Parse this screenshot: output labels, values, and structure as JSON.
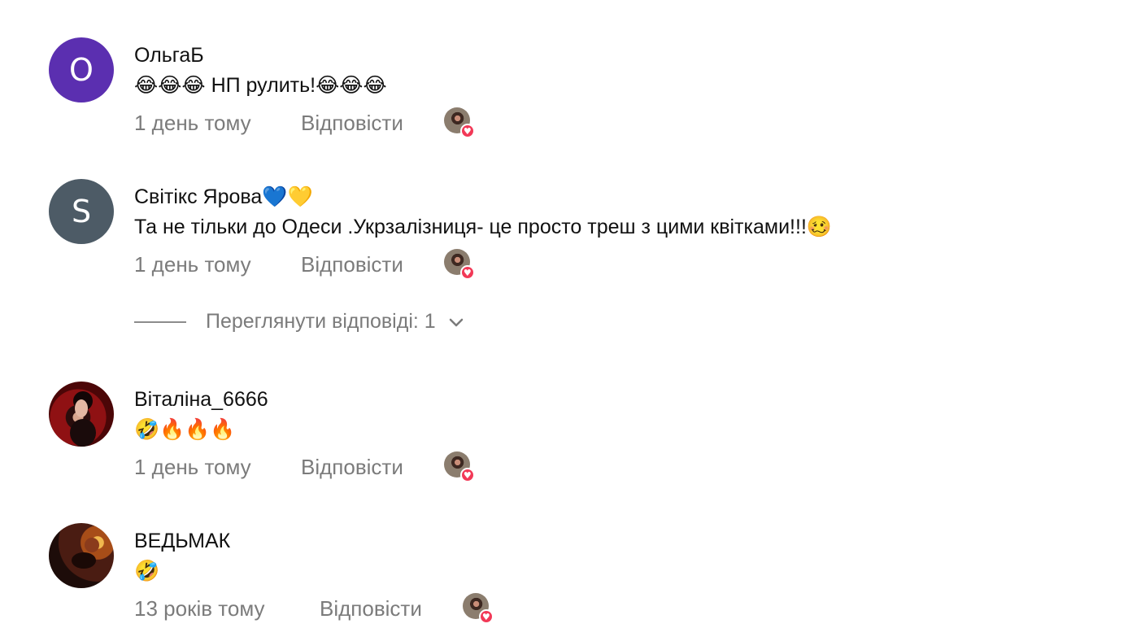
{
  "colors": {
    "secondary_text": "#7b7b7b",
    "primary_text": "#111111",
    "avatar_purple": "#5b2fb0",
    "avatar_slate": "#4d5b66",
    "like_heart": "#f23957"
  },
  "comments": [
    {
      "avatar_letter": "O",
      "name": "ОльгаБ",
      "text": "😂😂😂 НП рулить!😂😂😂",
      "time": "1 день тому",
      "reply_label": "Відповісти",
      "like_icon": "heart-icon"
    },
    {
      "avatar_letter": "S",
      "name": "Світікс Ярова💙💛",
      "text": "Та не тільки до Одеси .Укрзалізниця- це просто треш з цими квітками!!!🥴",
      "time": "1 день тому",
      "reply_label": "Відповісти",
      "like_icon": "heart-icon",
      "view_replies": "Переглянути відповіді: 1"
    },
    {
      "name": "Віталіна_6666",
      "text": "🤣🔥🔥🔥",
      "time": "1 день тому",
      "reply_label": "Відповісти",
      "like_icon": "heart-icon"
    },
    {
      "name": "ВЕДЬМАК",
      "text": "🤣",
      "time": "13 років тому",
      "reply_label": "Відповісти",
      "like_icon": "heart-icon"
    }
  ]
}
